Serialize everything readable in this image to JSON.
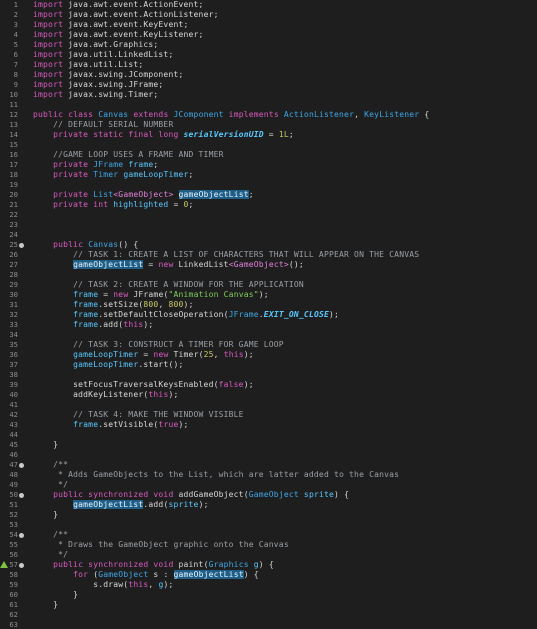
{
  "editor": {
    "lines": [
      {
        "n": "1",
        "fold": false,
        "tokens": [
          {
            "c": "kw",
            "t": "import"
          },
          {
            "c": "txt",
            "t": " java.awt.event.ActionEvent;"
          }
        ]
      },
      {
        "n": "2",
        "tokens": [
          {
            "c": "kw",
            "t": "import"
          },
          {
            "c": "txt",
            "t": " java.awt.event.ActionListener;"
          }
        ]
      },
      {
        "n": "3",
        "tokens": [
          {
            "c": "kw",
            "t": "import"
          },
          {
            "c": "txt",
            "t": " java.awt.event.KeyEvent;"
          }
        ]
      },
      {
        "n": "4",
        "tokens": [
          {
            "c": "kw",
            "t": "import"
          },
          {
            "c": "txt",
            "t": " java.awt.event.KeyListener;"
          }
        ]
      },
      {
        "n": "5",
        "tokens": [
          {
            "c": "kw",
            "t": "import"
          },
          {
            "c": "txt",
            "t": " java.awt.Graphics;"
          }
        ]
      },
      {
        "n": "6",
        "tokens": [
          {
            "c": "kw",
            "t": "import"
          },
          {
            "c": "txt",
            "t": " java.util.LinkedList;"
          }
        ]
      },
      {
        "n": "7",
        "tokens": [
          {
            "c": "kw",
            "t": "import"
          },
          {
            "c": "txt",
            "t": " java.util.List;"
          }
        ]
      },
      {
        "n": "8",
        "tokens": [
          {
            "c": "kw",
            "t": "import"
          },
          {
            "c": "txt",
            "t": " javax.swing.JComponent;"
          }
        ]
      },
      {
        "n": "9",
        "tokens": [
          {
            "c": "kw",
            "t": "import"
          },
          {
            "c": "txt",
            "t": " javax.swing.JFrame;"
          }
        ]
      },
      {
        "n": "10",
        "tokens": [
          {
            "c": "kw",
            "t": "import"
          },
          {
            "c": "txt",
            "t": " javax.swing.Timer;"
          }
        ]
      },
      {
        "n": "11",
        "tokens": []
      },
      {
        "n": "12",
        "tokens": [
          {
            "c": "kw",
            "t": "public class "
          },
          {
            "c": "type",
            "t": "Canvas"
          },
          {
            "c": "kw",
            "t": " extends "
          },
          {
            "c": "type",
            "t": "JComponent"
          },
          {
            "c": "kw",
            "t": " implements "
          },
          {
            "c": "type",
            "t": "ActionListener"
          },
          {
            "c": "txt",
            "t": ", "
          },
          {
            "c": "type",
            "t": "KeyListener"
          },
          {
            "c": "txt",
            "t": " {"
          }
        ]
      },
      {
        "n": "13",
        "tokens": [
          {
            "c": "cm",
            "t": "    // DEFAULT SERIAL NUMBER"
          }
        ]
      },
      {
        "n": "14",
        "tokens": [
          {
            "c": "kw",
            "t": "    private static final long "
          },
          {
            "c": "fld it",
            "t": "serialVersionUID"
          },
          {
            "c": "txt",
            "t": " = "
          },
          {
            "c": "num",
            "t": "1L"
          },
          {
            "c": "txt",
            "t": ";"
          }
        ]
      },
      {
        "n": "15",
        "tokens": []
      },
      {
        "n": "16",
        "tokens": [
          {
            "c": "cm",
            "t": "    //GAME LOOP USES A FRAME AND TIMER"
          }
        ]
      },
      {
        "n": "17",
        "tokens": [
          {
            "c": "kw",
            "t": "    private "
          },
          {
            "c": "type",
            "t": "JFrame"
          },
          {
            "c": "fld",
            "t": " frame"
          },
          {
            "c": "txt",
            "t": ";"
          }
        ]
      },
      {
        "n": "18",
        "tokens": [
          {
            "c": "kw",
            "t": "    private "
          },
          {
            "c": "type",
            "t": "Timer"
          },
          {
            "c": "fld",
            "t": " gameLoopTimer"
          },
          {
            "c": "txt",
            "t": ";"
          }
        ]
      },
      {
        "n": "19",
        "tokens": []
      },
      {
        "n": "20",
        "tokens": [
          {
            "c": "kw",
            "t": "    private "
          },
          {
            "c": "type",
            "t": "List"
          },
          {
            "c": "gen",
            "t": "<GameObject>"
          },
          {
            "c": "txt",
            "t": " "
          },
          {
            "c": "hl",
            "t": "gameObjectList"
          },
          {
            "c": "txt",
            "t": ";"
          }
        ]
      },
      {
        "n": "21",
        "tokens": [
          {
            "c": "kw",
            "t": "    private int "
          },
          {
            "c": "fld",
            "t": "highlighted"
          },
          {
            "c": "txt",
            "t": " = "
          },
          {
            "c": "num",
            "t": "0"
          },
          {
            "c": "txt",
            "t": ";"
          }
        ]
      },
      {
        "n": "22",
        "tokens": []
      },
      {
        "n": "23",
        "tokens": []
      },
      {
        "n": "24",
        "tokens": []
      },
      {
        "n": "25",
        "fold": true,
        "tokens": [
          {
            "c": "kw",
            "t": "    public "
          },
          {
            "c": "type",
            "t": "Canvas"
          },
          {
            "c": "txt",
            "t": "() {"
          }
        ]
      },
      {
        "n": "26",
        "tokens": [
          {
            "c": "cm",
            "t": "        // TASK 1: CREATE A LIST OF CHARACTERS THAT WILL APPEAR ON THE CANVAS"
          }
        ]
      },
      {
        "n": "27",
        "tokens": [
          {
            "c": "txt",
            "t": "        "
          },
          {
            "c": "hl",
            "t": "gameObjectList"
          },
          {
            "c": "txt",
            "t": " = "
          },
          {
            "c": "kw",
            "t": "new "
          },
          {
            "c": "txt",
            "t": "LinkedList"
          },
          {
            "c": "gen",
            "t": "<GameObject>"
          },
          {
            "c": "txt",
            "t": "();"
          }
        ]
      },
      {
        "n": "28",
        "tokens": []
      },
      {
        "n": "29",
        "tokens": [
          {
            "c": "cm",
            "t": "        // TASK 2: CREATE A WINDOW FOR THE APPLICATION"
          }
        ]
      },
      {
        "n": "30",
        "tokens": [
          {
            "c": "fld",
            "t": "        frame"
          },
          {
            "c": "txt",
            "t": " = "
          },
          {
            "c": "kw",
            "t": "new "
          },
          {
            "c": "txt",
            "t": "JFrame("
          },
          {
            "c": "str",
            "t": "\"Animation Canvas\""
          },
          {
            "c": "txt",
            "t": ");"
          }
        ]
      },
      {
        "n": "31",
        "tokens": [
          {
            "c": "fld",
            "t": "        frame"
          },
          {
            "c": "txt",
            "t": ".setSize("
          },
          {
            "c": "num",
            "t": "800"
          },
          {
            "c": "txt",
            "t": ", "
          },
          {
            "c": "num",
            "t": "800"
          },
          {
            "c": "txt",
            "t": ");"
          }
        ]
      },
      {
        "n": "32",
        "tokens": [
          {
            "c": "fld",
            "t": "        frame"
          },
          {
            "c": "txt",
            "t": ".setDefaultCloseOperation("
          },
          {
            "c": "type",
            "t": "JFrame"
          },
          {
            "c": "txt",
            "t": "."
          },
          {
            "c": "fld it",
            "t": "EXIT_ON_CLOSE"
          },
          {
            "c": "txt",
            "t": ");"
          }
        ]
      },
      {
        "n": "33",
        "tokens": [
          {
            "c": "fld",
            "t": "        frame"
          },
          {
            "c": "txt",
            "t": ".add("
          },
          {
            "c": "kw",
            "t": "this"
          },
          {
            "c": "txt",
            "t": ");"
          }
        ]
      },
      {
        "n": "34",
        "tokens": []
      },
      {
        "n": "35",
        "tokens": [
          {
            "c": "cm",
            "t": "        // TASK 3: CONSTRUCT A TIMER FOR GAME LOOP"
          }
        ]
      },
      {
        "n": "36",
        "tokens": [
          {
            "c": "fld",
            "t": "        gameLoopTimer"
          },
          {
            "c": "txt",
            "t": " = "
          },
          {
            "c": "kw",
            "t": "new "
          },
          {
            "c": "txt",
            "t": "Timer("
          },
          {
            "c": "num",
            "t": "25"
          },
          {
            "c": "txt",
            "t": ", "
          },
          {
            "c": "kw",
            "t": "this"
          },
          {
            "c": "txt",
            "t": ");"
          }
        ]
      },
      {
        "n": "37",
        "tokens": [
          {
            "c": "fld",
            "t": "        gameLoopTimer"
          },
          {
            "c": "txt",
            "t": ".start();"
          }
        ]
      },
      {
        "n": "38",
        "tokens": []
      },
      {
        "n": "39",
        "tokens": [
          {
            "c": "txt",
            "t": "        setFocusTraversalKeysEnabled("
          },
          {
            "c": "kw",
            "t": "false"
          },
          {
            "c": "txt",
            "t": ");"
          }
        ]
      },
      {
        "n": "40",
        "tokens": [
          {
            "c": "txt",
            "t": "        addKeyListener("
          },
          {
            "c": "kw",
            "t": "this"
          },
          {
            "c": "txt",
            "t": ");"
          }
        ]
      },
      {
        "n": "41",
        "tokens": []
      },
      {
        "n": "42",
        "tokens": [
          {
            "c": "cm",
            "t": "        // TASK 4: MAKE THE WINDOW VISIBLE"
          }
        ]
      },
      {
        "n": "43",
        "tokens": [
          {
            "c": "fld",
            "t": "        frame"
          },
          {
            "c": "txt",
            "t": ".setVisible("
          },
          {
            "c": "kw",
            "t": "true"
          },
          {
            "c": "txt",
            "t": ");"
          }
        ]
      },
      {
        "n": "44",
        "tokens": []
      },
      {
        "n": "45",
        "tokens": [
          {
            "c": "txt",
            "t": "    }"
          }
        ]
      },
      {
        "n": "46",
        "tokens": []
      },
      {
        "n": "47",
        "fold": true,
        "tokens": [
          {
            "c": "cm",
            "t": "    /**"
          }
        ]
      },
      {
        "n": "48",
        "tokens": [
          {
            "c": "cm",
            "t": "     * Adds GameObjects to the List, which are latter added to the Canvas"
          }
        ]
      },
      {
        "n": "49",
        "tokens": [
          {
            "c": "cm",
            "t": "     */"
          }
        ]
      },
      {
        "n": "50",
        "fold": true,
        "tokens": [
          {
            "c": "kw",
            "t": "    public synchronized void "
          },
          {
            "c": "txt",
            "t": "addGameObject("
          },
          {
            "c": "type",
            "t": "GameObject"
          },
          {
            "c": "txt",
            "t": " "
          },
          {
            "c": "fld",
            "t": "sprite"
          },
          {
            "c": "txt",
            "t": ") {"
          }
        ]
      },
      {
        "n": "51",
        "tokens": [
          {
            "c": "txt",
            "t": "        "
          },
          {
            "c": "hl",
            "t": "gameObjectList"
          },
          {
            "c": "txt",
            "t": ".add("
          },
          {
            "c": "fld",
            "t": "sprite"
          },
          {
            "c": "txt",
            "t": ");"
          }
        ]
      },
      {
        "n": "52",
        "tokens": [
          {
            "c": "txt",
            "t": "    }"
          }
        ]
      },
      {
        "n": "53",
        "tokens": []
      },
      {
        "n": "54",
        "fold": true,
        "tokens": [
          {
            "c": "cm",
            "t": "    /**"
          }
        ]
      },
      {
        "n": "55",
        "tokens": [
          {
            "c": "cm",
            "t": "     * Draws the GameObject graphic onto the Canvas"
          }
        ]
      },
      {
        "n": "56",
        "tokens": [
          {
            "c": "cm",
            "t": "     */"
          }
        ]
      },
      {
        "n": "57",
        "fold": true,
        "warn": true,
        "tokens": [
          {
            "c": "kw",
            "t": "    public synchronized void "
          },
          {
            "c": "txt",
            "t": "paint("
          },
          {
            "c": "type",
            "t": "Graphics"
          },
          {
            "c": "txt",
            "t": " "
          },
          {
            "c": "fld",
            "t": "g"
          },
          {
            "c": "txt",
            "t": ") {"
          }
        ]
      },
      {
        "n": "58",
        "tokens": [
          {
            "c": "kw",
            "t": "        for "
          },
          {
            "c": "txt",
            "t": "("
          },
          {
            "c": "type",
            "t": "GameObject"
          },
          {
            "c": "txt",
            "t": " s : "
          },
          {
            "c": "hl",
            "t": "gameObjectList"
          },
          {
            "c": "txt",
            "t": ") {"
          }
        ]
      },
      {
        "n": "59",
        "tokens": [
          {
            "c": "txt",
            "t": "            s.draw("
          },
          {
            "c": "kw",
            "t": "this"
          },
          {
            "c": "txt",
            "t": ", "
          },
          {
            "c": "fld",
            "t": "g"
          },
          {
            "c": "txt",
            "t": ");"
          }
        ]
      },
      {
        "n": "60",
        "tokens": [
          {
            "c": "txt",
            "t": "        }"
          }
        ]
      },
      {
        "n": "61",
        "tokens": [
          {
            "c": "txt",
            "t": "    }"
          }
        ]
      },
      {
        "n": "62",
        "tokens": []
      },
      {
        "n": "63",
        "tokens": []
      }
    ]
  }
}
